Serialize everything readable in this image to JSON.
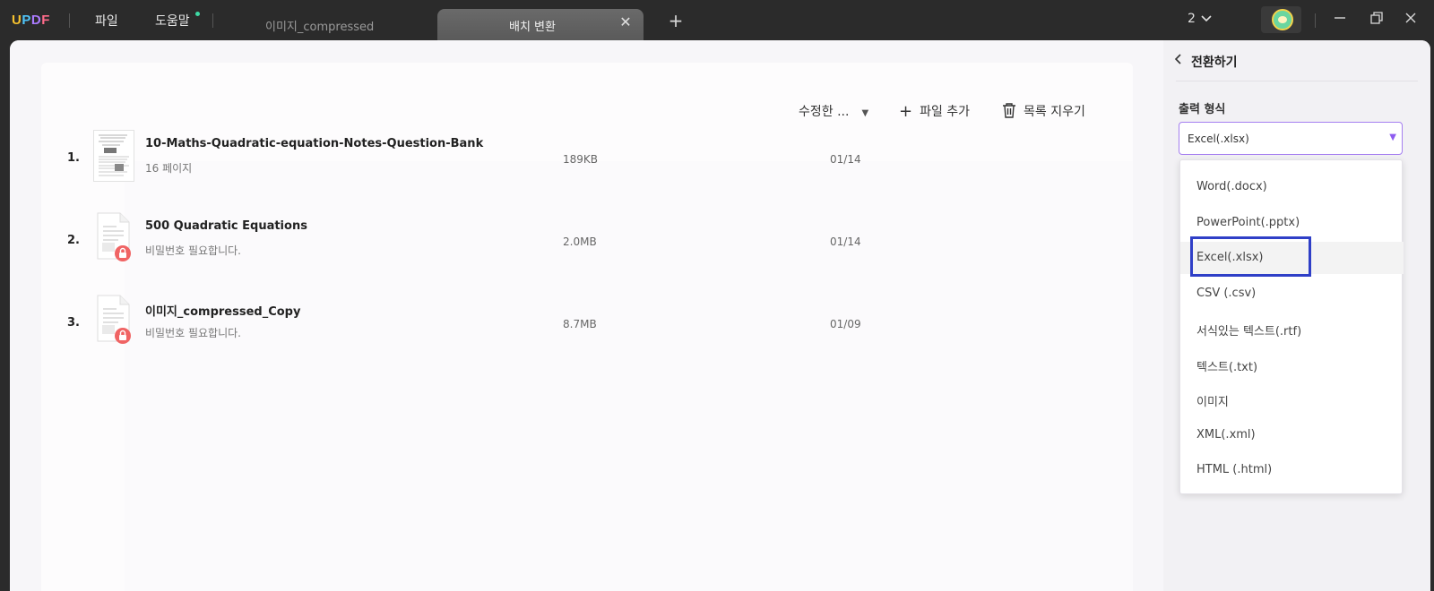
{
  "app": {
    "logo": "UPDF"
  },
  "menu": {
    "file": "파일",
    "help": "도움말"
  },
  "tabs": [
    {
      "label": "이미지_compressed",
      "active": false
    },
    {
      "label": "배치 변환",
      "active": true
    }
  ],
  "window": {
    "count": "2"
  },
  "toolbar": {
    "sort_label": "수정한 ...",
    "add_file": "파일 추가",
    "clear_list": "목록 지우기"
  },
  "files": [
    {
      "num": "1.",
      "name": "10-Maths-Quadratic-equation-Notes-Question-Bank",
      "sub": "16 페이지",
      "size": "189KB",
      "pages": "01/14",
      "locked": false
    },
    {
      "num": "2.",
      "name": "500 Quadratic Equations",
      "sub": "비밀번호 필요합니다.",
      "size": "2.0MB",
      "pages": "01/14",
      "locked": true
    },
    {
      "num": "3.",
      "name": "이미지_compressed_Copy",
      "sub": "비밀번호 필요합니다.",
      "size": "8.7MB",
      "pages": "01/09",
      "locked": true
    }
  ],
  "panel": {
    "title": "전환하기",
    "output_label": "출력 형식",
    "selected": "Excel(.xlsx)",
    "options": [
      "Word(.docx)",
      "PowerPoint(.pptx)",
      "Excel(.xlsx)",
      "CSV (.csv)",
      "서식있는 텍스트(.rtf)",
      "텍스트(.txt)",
      "이미지",
      "XML(.xml)",
      "HTML (.html)"
    ]
  },
  "colors": {
    "accent": "#a57ff0",
    "highlight": "#2f3fc7",
    "lock": "#f06464"
  }
}
